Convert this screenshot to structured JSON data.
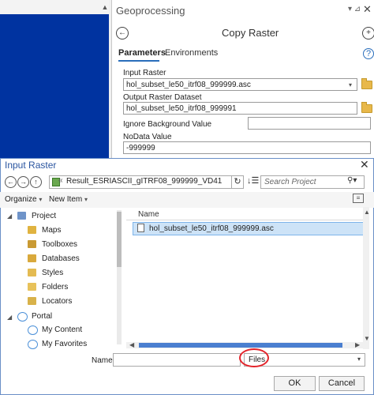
{
  "geoprocessing": {
    "pane_title": "Geoprocessing",
    "tool_title": "Copy Raster",
    "tabs": [
      "Parameters",
      "Environments"
    ],
    "help_glyph": "?",
    "params": [
      {
        "label": "Input Raster",
        "value": "hol_subset_le50_itrf08_999999.asc"
      },
      {
        "label": "Output Raster Dataset",
        "value": "hol_subset_le50_itrf08_999991"
      },
      {
        "label": "Ignore Background Value",
        "value": ""
      },
      {
        "label": "NoData Value",
        "value": "-999999"
      }
    ]
  },
  "dialog": {
    "title": "Input Raster",
    "address": "Result_ESRIASCII_gITRF08_999999_VD41",
    "address_prefix": "«",
    "search_placeholder": "Search Project",
    "toolbar": {
      "organize": "Organize",
      "new_item": "New Item"
    },
    "tree": [
      {
        "label": "Project",
        "icon": "project-icon"
      },
      {
        "label": "Maps",
        "icon": "maps-icon"
      },
      {
        "label": "Toolboxes",
        "icon": "toolboxes-icon"
      },
      {
        "label": "Databases",
        "icon": "databases-icon"
      },
      {
        "label": "Styles",
        "icon": "styles-icon"
      },
      {
        "label": "Folders",
        "icon": "folders-icon"
      },
      {
        "label": "Locators",
        "icon": "locators-icon"
      },
      {
        "label": "Portal",
        "icon": "portal-icon"
      },
      {
        "label": "My Content",
        "icon": "my-content-icon"
      },
      {
        "label": "My Favorites",
        "icon": "my-favorites-icon"
      }
    ],
    "column_header": "Name",
    "files": [
      "hol_subset_le50_itrf08_999999.asc"
    ],
    "name_label": "Name",
    "name_value": "",
    "filter_value": "Files",
    "ok_label": "OK",
    "cancel_label": "Cancel"
  },
  "colors": {
    "dialog_border": "#6a8fc7",
    "selection_fill": "#cde3f7",
    "annotation_circle": "#e3242b",
    "background_blue": "#0033a0"
  }
}
